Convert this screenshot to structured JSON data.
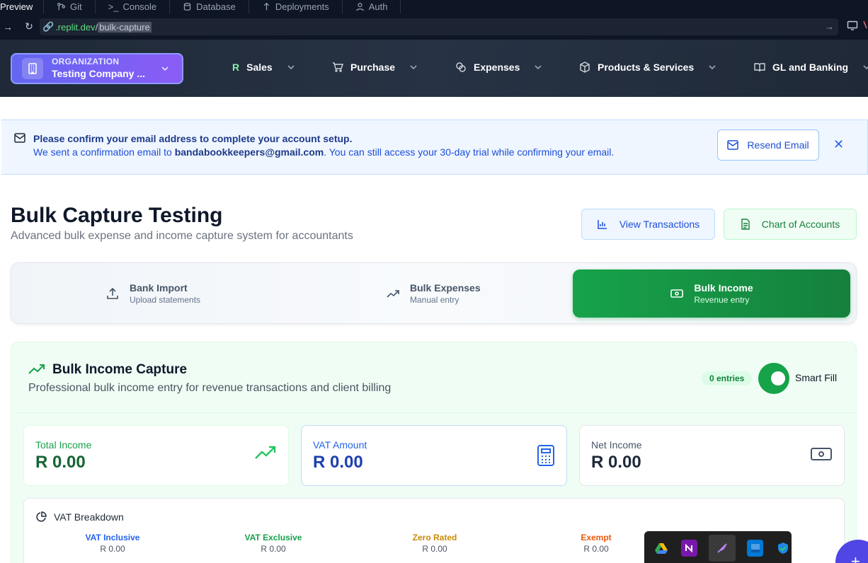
{
  "replit_tabs": [
    "Preview",
    "Git",
    "Console",
    "Database",
    "Deployments",
    "Auth"
  ],
  "url": {
    "host": ".replit.dev",
    "path": "bulk-capture"
  },
  "header": {
    "org_label": "ORGANIZATION",
    "org_name": "Testing Company ...",
    "nav": [
      "Sales",
      "Purchase",
      "Expenses",
      "Products & Services",
      "GL and Banking"
    ],
    "sales_icon_letter": "R"
  },
  "banner": {
    "title": "Please confirm your email address to complete your account setup.",
    "msg_prefix": "We sent a confirmation email to ",
    "email": "bandabookkeepers@gmail.com",
    "msg_suffix": ". You can still access your 30-day trial while confirming your email.",
    "resend_label": "Resend Email",
    "close_glyph": "✕"
  },
  "page": {
    "title": "Bulk Capture Testing",
    "subtitle": "Advanced bulk expense and income capture system for accountants",
    "view_transactions": "View Transactions",
    "chart_of_accounts": "Chart of Accounts"
  },
  "mode_tabs": [
    {
      "label": "Bank Import",
      "sub": "Upload statements",
      "icon": "upload-icon",
      "active": false
    },
    {
      "label": "Bulk Expenses",
      "sub": "Manual entry",
      "icon": "trending-icon",
      "active": false
    },
    {
      "label": "Bulk Income",
      "sub": "Revenue entry",
      "icon": "banknote-icon",
      "active": true
    }
  ],
  "capture": {
    "title": "Bulk Income Capture",
    "subtitle": "Professional bulk income entry for revenue transactions and client billing",
    "entries_badge": "0 entries",
    "smart_fill_label": "Smart Fill",
    "smart_fill_on": true
  },
  "stats": [
    {
      "label": "Total Income",
      "value": "R 0.00",
      "icon": "trending-up-icon"
    },
    {
      "label": "VAT Amount",
      "value": "R 0.00",
      "icon": "calculator-icon"
    },
    {
      "label": "Net Income",
      "value": "R 0.00",
      "icon": "banknote-icon"
    }
  ],
  "vat_breakdown": {
    "title": "VAT Breakdown",
    "columns": [
      {
        "label": "VAT Inclusive",
        "value": "R 0.00",
        "color": "#2563eb"
      },
      {
        "label": "VAT Exclusive",
        "value": "R 0.00",
        "color": "#16a34a"
      },
      {
        "label": "Zero Rated",
        "value": "R 0.00",
        "color": "#ca8a04"
      },
      {
        "label": "Exempt",
        "value": "R 0.00",
        "color": "#ea580c"
      }
    ]
  },
  "colors": {
    "accent_green": "#16a34a",
    "accent_blue": "#2563eb",
    "header_bg": "#1f2937",
    "org_gradient": "#6366f1"
  },
  "taskbar_icons": [
    "drive-icon",
    "onenote-icon",
    "feather-app-icon",
    "blue-app-icon",
    "defender-icon"
  ],
  "fab_glyph": "+"
}
